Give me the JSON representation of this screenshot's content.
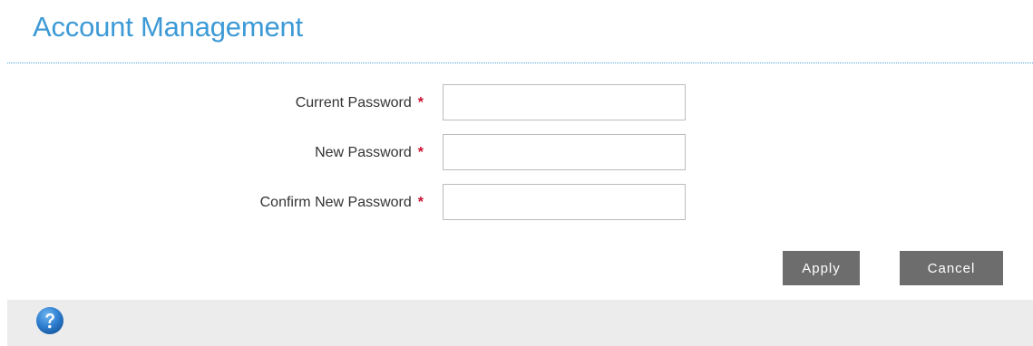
{
  "page": {
    "title": "Account Management"
  },
  "form": {
    "fields": [
      {
        "label": "Current Password",
        "required_mark": "*",
        "value": "",
        "placeholder": ""
      },
      {
        "label": "New Password",
        "required_mark": "*",
        "value": "",
        "placeholder": ""
      },
      {
        "label": "Confirm New Password",
        "required_mark": "*",
        "value": "",
        "placeholder": ""
      }
    ]
  },
  "actions": {
    "apply_label": "Apply",
    "cancel_label": "Cancel"
  },
  "footer": {
    "help_icon": "question-circle-icon"
  },
  "colors": {
    "title": "#3d9ad6",
    "required": "#c8102e",
    "button": "#6d6d6d",
    "footer": "#ececec",
    "help_icon": "#2f7fd0"
  }
}
